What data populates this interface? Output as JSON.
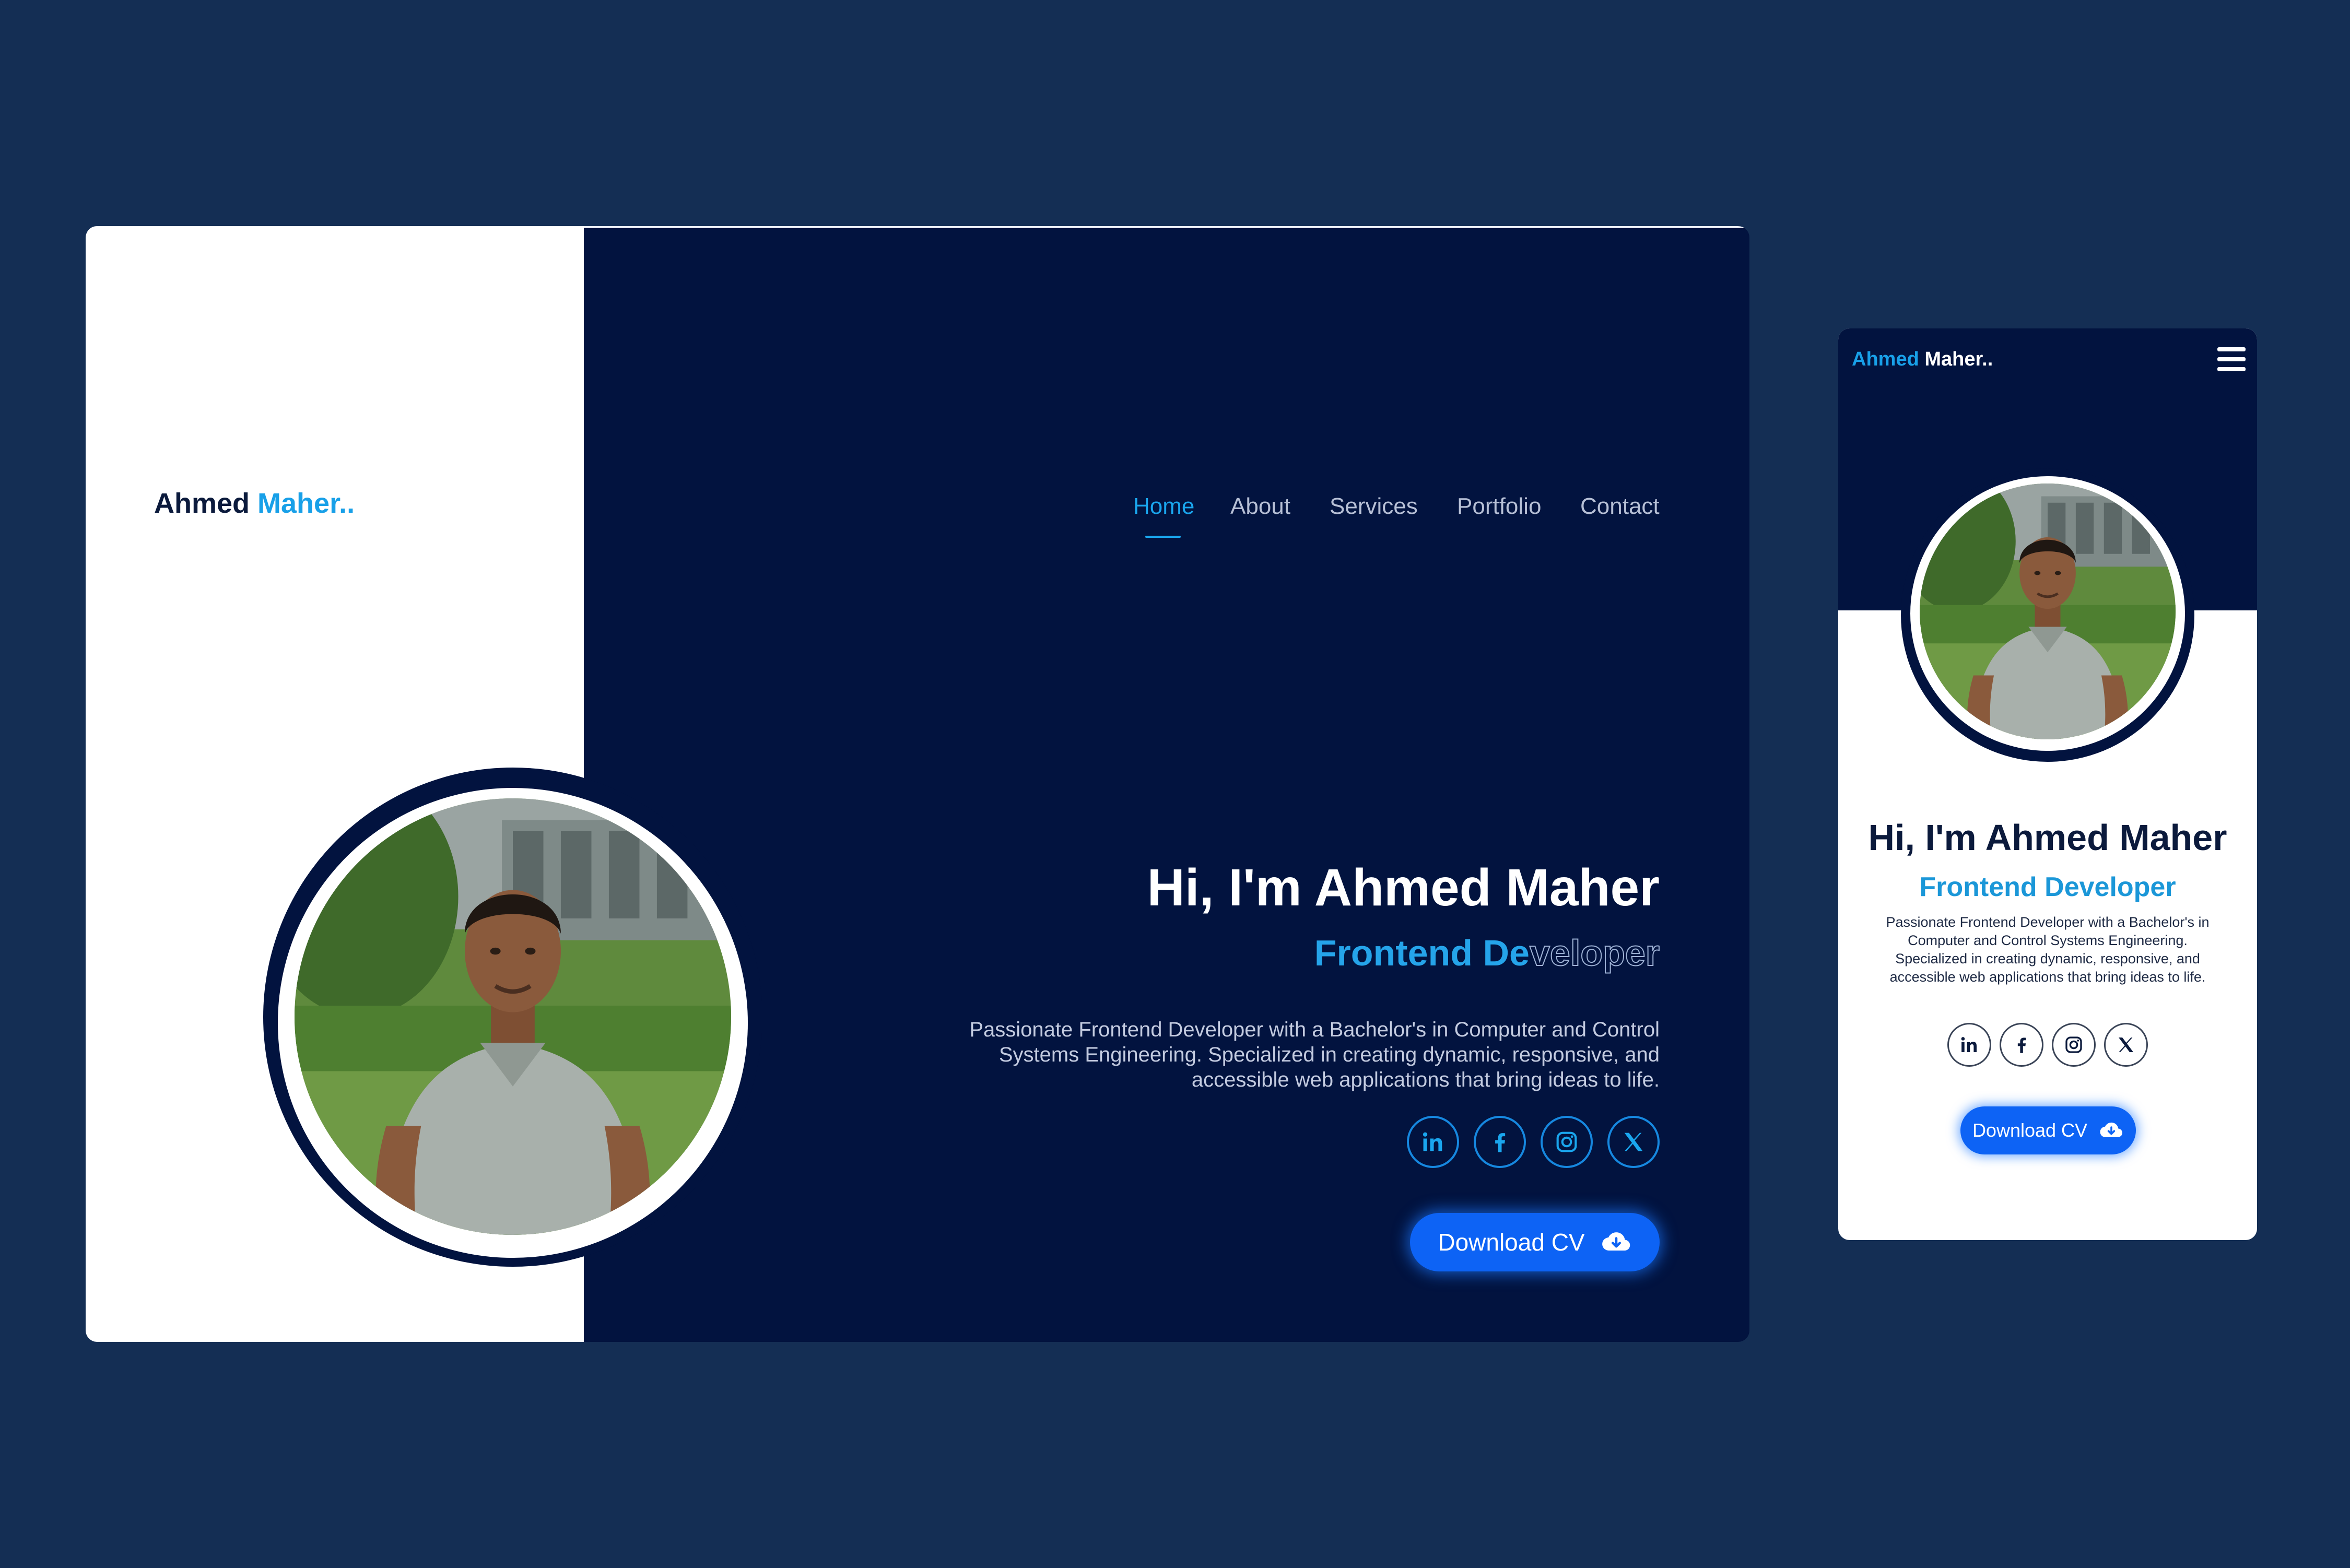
{
  "colors": {
    "page_background": "#142e54",
    "hero_background": "#02133f",
    "accent": "#1aa6ee",
    "button": "#0d63f5"
  },
  "desktop": {
    "logo": {
      "first": "Ahmed",
      "second": "Maher.."
    },
    "nav": {
      "items": [
        {
          "label": "Home",
          "active": true
        },
        {
          "label": "About",
          "active": false
        },
        {
          "label": "Services",
          "active": false
        },
        {
          "label": "Portfolio",
          "active": false
        },
        {
          "label": "Contact",
          "active": false
        }
      ]
    },
    "hero": {
      "title": "Hi, I'm Ahmed Maher",
      "role_solid": "Frontend De",
      "role_outline": "veloper",
      "description": "Passionate Frontend Developer with a Bachelor's in Computer and Control Systems Engineering. Specialized in creating dynamic, responsive, and accessible web applications that bring ideas to life.",
      "socials": [
        "linkedin-icon",
        "facebook-icon",
        "instagram-icon",
        "x-twitter-icon"
      ],
      "button_label": "Download CV",
      "button_icon": "cloud-download-icon"
    }
  },
  "mobile": {
    "logo": {
      "first": "Ahmed",
      "second": "Maher.."
    },
    "menu_icon": "hamburger-menu-icon",
    "hero": {
      "title": "Hi, I'm Ahmed Maher",
      "role": "Frontend Developer",
      "description": "Passionate Frontend Developer with a Bachelor's in Computer and Control Systems Engineering. Specialized in creating dynamic, responsive, and accessible web applications that bring ideas to life.",
      "socials": [
        "linkedin-icon",
        "facebook-icon",
        "instagram-icon",
        "x-twitter-icon"
      ],
      "button_label": "Download CV",
      "button_icon": "cloud-download-icon"
    }
  }
}
